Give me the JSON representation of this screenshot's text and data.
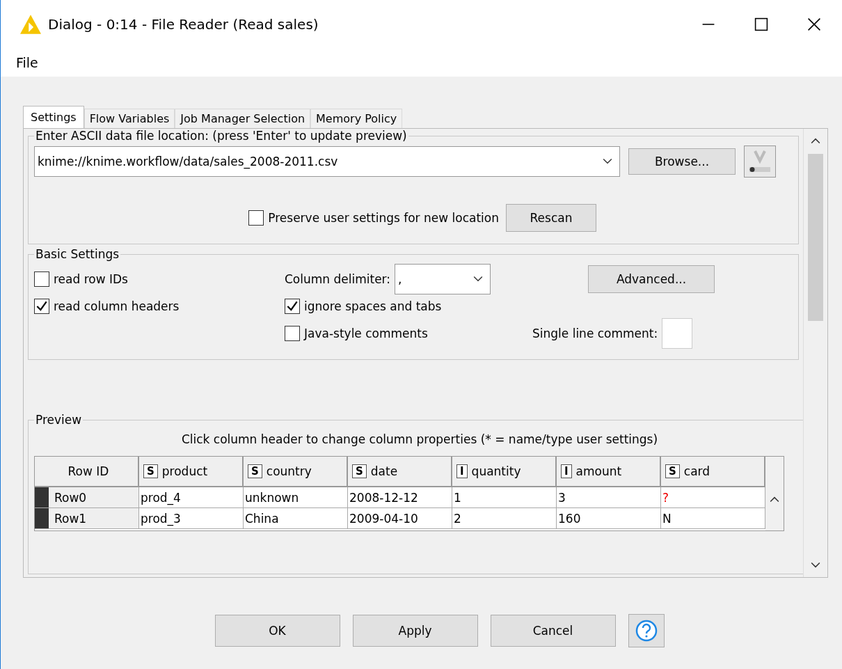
{
  "window": {
    "title": "Dialog - 0:14 - File Reader (Read sales)"
  },
  "menu": [
    "File"
  ],
  "tabs": [
    {
      "label": "Settings",
      "selected": true
    },
    {
      "label": "Flow Variables",
      "selected": false
    },
    {
      "label": "Job Manager Selection",
      "selected": false
    },
    {
      "label": "Memory Policy",
      "selected": false
    }
  ],
  "location": {
    "legend": "Enter ASCII data file location: (press 'Enter' to update preview)",
    "value": "knime://knime.workflow/data/sales_2008-2011.csv",
    "browse": "Browse...",
    "preserve": {
      "label": "Preserve user settings for new location",
      "checked": false
    },
    "rescan": "Rescan"
  },
  "basic": {
    "legend": "Basic Settings",
    "read_row_ids": {
      "label": "read row IDs",
      "checked": false
    },
    "read_column_headers": {
      "label": "read column headers",
      "checked": true
    },
    "delimiter_label": "Column delimiter:",
    "delimiter": ",",
    "ignore_spaces": {
      "label": "ignore spaces and tabs",
      "checked": true
    },
    "java_comments": {
      "label": "Java-style comments",
      "checked": false
    },
    "advanced": "Advanced...",
    "single_line_comment": "Single line comment:"
  },
  "preview": {
    "legend": "Preview",
    "hint": "Click column header to change column properties (* = name/type user settings)",
    "columns": [
      {
        "name": "Row ID"
      },
      {
        "type": "S",
        "name": "product"
      },
      {
        "type": "S",
        "name": "country"
      },
      {
        "type": "S",
        "name": "date"
      },
      {
        "type": "I",
        "name": "quantity"
      },
      {
        "type": "I",
        "name": "amount"
      },
      {
        "type": "S",
        "name": "card"
      }
    ],
    "rows": [
      {
        "cells": [
          {
            "text": "Row0",
            "missing": false
          },
          {
            "text": "prod_4",
            "missing": false
          },
          {
            "text": "unknown",
            "missing": false
          },
          {
            "text": "2008-12-12",
            "missing": false
          },
          {
            "text": "1",
            "missing": false
          },
          {
            "text": "3",
            "missing": false
          },
          {
            "text": "?",
            "missing": true
          }
        ]
      },
      {
        "cells": [
          {
            "text": "Row1",
            "missing": false
          },
          {
            "text": "prod_3",
            "missing": false
          },
          {
            "text": "China",
            "missing": false
          },
          {
            "text": "2009-04-10",
            "missing": false
          },
          {
            "text": "2",
            "missing": false
          },
          {
            "text": "160",
            "missing": false
          },
          {
            "text": "N",
            "missing": false
          }
        ]
      }
    ]
  },
  "buttons": [
    "OK",
    "Apply",
    "Cancel"
  ]
}
